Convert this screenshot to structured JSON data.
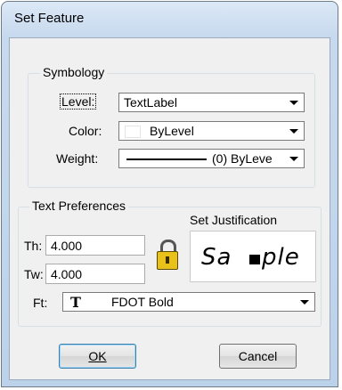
{
  "window": {
    "title": "Set Feature"
  },
  "symbology": {
    "group_label": "Symbology",
    "level_label": "Level:",
    "level_value": "TextLabel",
    "color_label": "Color:",
    "color_value": "ByLevel",
    "weight_label": "Weight:",
    "weight_value": "(0) ByLeve"
  },
  "text_preferences": {
    "group_label": "Text Preferences",
    "th_label": "Th:",
    "th_value": "4.000",
    "tw_label": "Tw:",
    "tw_value": "4.000",
    "set_justification_label": "Set Justification",
    "sample_text_left": "Sa",
    "sample_text_right": "ple",
    "ft_label": "Ft:",
    "font_icon_glyph": "T",
    "font_value": "FDOT Bold"
  },
  "buttons": {
    "ok": "OK",
    "cancel": "Cancel"
  },
  "colors": {
    "lock_body": "#e8c21a",
    "focus_border": "#3c7fb1"
  }
}
